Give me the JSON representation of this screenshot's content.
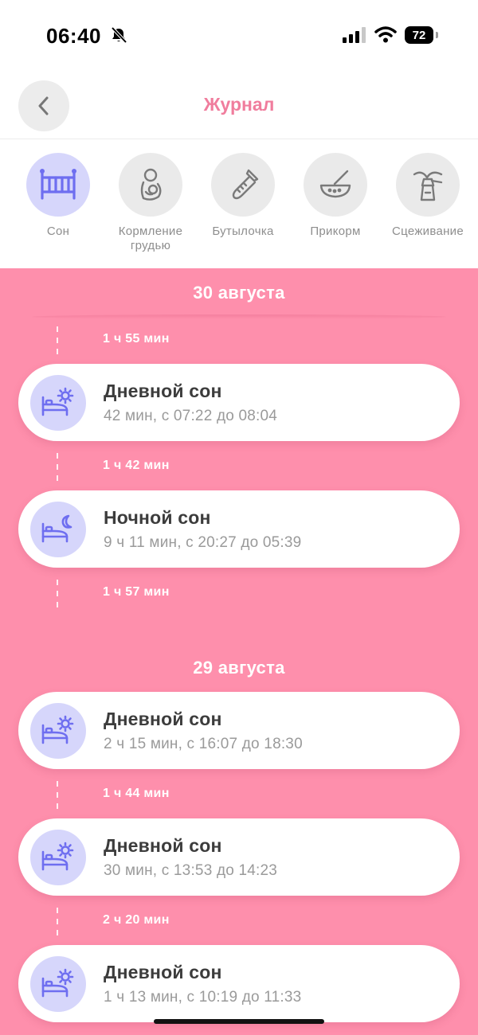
{
  "status_bar": {
    "time": "06:40",
    "battery": "72"
  },
  "header": {
    "title": "Журнал",
    "back_icon": "chevron-left-icon"
  },
  "categories": [
    {
      "label": "Сон",
      "icon": "crib-icon",
      "active": true
    },
    {
      "label": "Кормление грудью",
      "icon": "breastfeeding-icon",
      "active": false
    },
    {
      "label": "Бутылочка",
      "icon": "bottle-icon",
      "active": false
    },
    {
      "label": "Прикорм",
      "icon": "bowl-icon",
      "active": false
    },
    {
      "label": "Сцеживание",
      "icon": "breast-pump-icon",
      "active": false
    }
  ],
  "days": [
    {
      "date": "30 августа",
      "gaps": [
        "1 ч 55 мин",
        "1 ч 42 мин",
        "1 ч 57 мин"
      ],
      "entries": [
        {
          "title": "Дневной сон",
          "detail": "42 мин, с 07:22 до 08:04",
          "icon": "day-sleep-icon"
        },
        {
          "title": "Ночной сон",
          "detail": "9 ч 11 мин, с 20:27 до 05:39",
          "icon": "night-sleep-icon"
        }
      ]
    },
    {
      "date": "29 августа",
      "gaps": [
        "1 ч 44 мин",
        "2 ч 20 мин"
      ],
      "entries": [
        {
          "title": "Дневной сон",
          "detail": "2 ч 15 мин, с 16:07 до 18:30",
          "icon": "day-sleep-icon"
        },
        {
          "title": "Дневной сон",
          "detail": "30 мин, с 13:53 до 14:23",
          "icon": "day-sleep-icon"
        },
        {
          "title": "Дневной сон",
          "detail": "1 ч 13 мин, с 10:19 до 11:33",
          "icon": "day-sleep-icon"
        }
      ]
    }
  ],
  "colors": {
    "accent_pink": "#f07d9d",
    "background_pink": "#fe8fac",
    "icon_purple": "#6e6ef0",
    "icon_bg": "#d6d6fb"
  }
}
